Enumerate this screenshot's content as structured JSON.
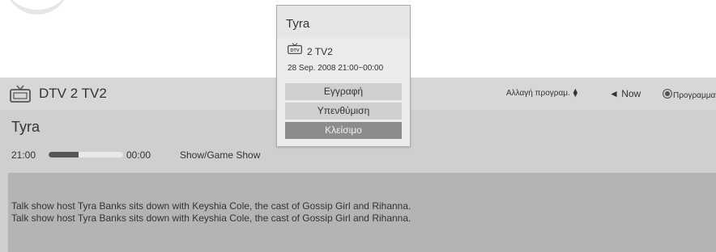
{
  "channel_bar": {
    "label": "DTV 2  TV2",
    "hints": {
      "change_program": "Αλλαγή προγραμ.",
      "now": "◄ Now",
      "schedule": "Προγραμματισμός"
    }
  },
  "program": {
    "title": "Tyra",
    "start_time": "21:00",
    "end_time": "00:00",
    "progress": 0.4,
    "genre": "Show/Game Show",
    "description_lines": [
      "Talk show host Tyra Banks sits down with Keyshia Cole, the cast of Gossip Girl and Rihanna.",
      "Talk show host Tyra Banks sits down with Keyshia Cole, the cast of Gossip Girl and Rihanna."
    ]
  },
  "popup": {
    "title": "Tyra",
    "channel": "2 TV2",
    "datetime": "28 Sep. 2008 21:00~00:00",
    "buttons": {
      "record": "Εγγραφή",
      "reminder": "Υπενθύμιση",
      "close": "Κλείσιμο"
    }
  },
  "colors": {
    "panel": "#cfcfcf",
    "description_bg": "#b4b4b4",
    "selected_button": "#8c8c8c",
    "text": "#333333"
  },
  "icons": {
    "tv": "tv-icon",
    "dtv": "dtv-icon",
    "updown": "up-down-arrows-icon",
    "record_dot": "red-button-icon"
  }
}
